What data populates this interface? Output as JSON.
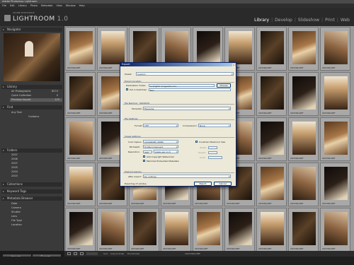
{
  "window": {
    "title": "Adobe Photoshop Lightroom"
  },
  "menu": [
    "File",
    "Edit",
    "Library",
    "Photo",
    "Metadata",
    "View",
    "Window",
    "Help"
  ],
  "identity": {
    "small": "ADOBE PHOTOSHOP",
    "name": "LIGHTROOM",
    "version": "1.0"
  },
  "modules": [
    "Library",
    "Develop",
    "Slideshow",
    "Print",
    "Web"
  ],
  "left_panel": {
    "navigator": "Navigator",
    "library": "Library",
    "library_items": [
      {
        "label": "All Photographs",
        "count": "8274"
      },
      {
        "label": "Quick Collection",
        "count": "0"
      },
      {
        "label": "Previous Import",
        "count": "125"
      }
    ],
    "find": "Find",
    "find_items": [
      "Any Text",
      "Contains"
    ],
    "folders": "Folders",
    "folder_items": [
      "2007",
      "2006",
      "2007",
      "2005",
      "2004",
      "2003"
    ],
    "collections": "Collections",
    "keyword_tags": "Keyword Tags",
    "metadata_browser": "Metadata Browser",
    "metadata_items": [
      "Date",
      "Camera",
      "Shutter",
      "Lens",
      "File Type",
      "Location"
    ],
    "import_button": "Import...",
    "export_button": "Export..."
  },
  "grid": {
    "rows": [
      [
        "a",
        "b",
        "c",
        "d",
        "e",
        "b",
        "c",
        "a",
        "d"
      ],
      [
        "c",
        "a",
        "e",
        "b",
        "d",
        "a",
        "c",
        "e",
        "b"
      ],
      [
        "d",
        "e",
        "b",
        "a",
        "c",
        "d",
        "e",
        "b",
        "a"
      ],
      [
        "b",
        "c",
        "a",
        "e",
        "d",
        "c",
        "a",
        "d",
        "e"
      ],
      [
        "e",
        "d",
        "c",
        "b",
        "a",
        "e",
        "b",
        "c",
        "d"
      ]
    ],
    "label": "20070604.NEF"
  },
  "filmstrip": {
    "sort_label": "Sort",
    "sort_value": "Import Order",
    "thumbnails": "Thumbnails",
    "filename": "20070604.NEF"
  },
  "export": {
    "title": "Export",
    "preset_label": "Preset:",
    "preset_value": "Custom",
    "export_location": "Export Location",
    "destination_label": "Destination Folder:",
    "destination_value": "G:\\Digital Images\\Source",
    "choose_button": "Choose",
    "subfolder_label": "Put in Subfolder:",
    "subfolder_value": "Nav",
    "file_naming": "File Naming: _DSC0034",
    "template_label": "Template:",
    "template_value": "Filename",
    "file_settings": "File Settings",
    "format_label": "Format:",
    "format_value": "TIFF",
    "compression_label": "Compression:",
    "compression_value": "None",
    "image_settings": "Image Settings",
    "color_space_label": "Color Space:",
    "color_space_value": "AdobeRGB (1998)",
    "bit_depth_label": "Bit Depth:",
    "bit_depth_value": "8 bits/component",
    "resolution_label": "Resolution:",
    "resolution_value": "240",
    "resolution_unit": "pixels per inch",
    "constrain_label": "Constrain Maximum Size",
    "width_label": "Width:",
    "height_label": "Height:",
    "units_label": "Units:",
    "copyright_label": "Add Copyright Watermark",
    "minimize_label": "Minimize Embedded Metadata",
    "post_processing": "Post-processing",
    "after_export_label": "After export:",
    "after_export_value": "Do nothing",
    "status": "Exporting 27 photos.",
    "export_button": "Export",
    "cancel_button": "Cancel"
  }
}
